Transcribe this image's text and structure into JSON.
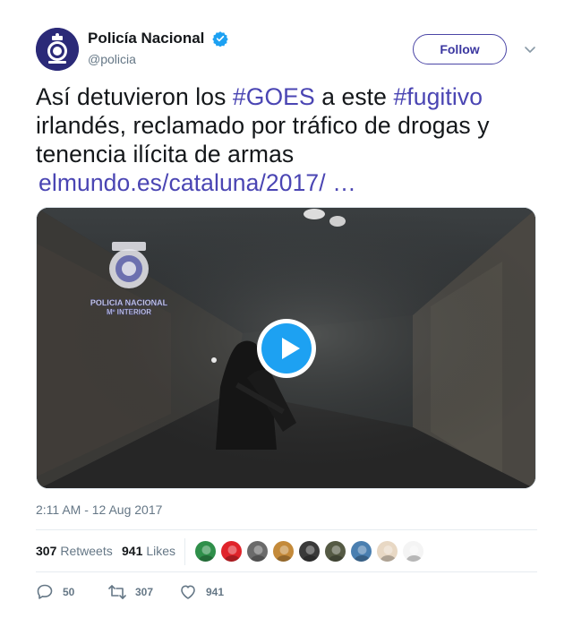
{
  "account": {
    "display_name": "Policía Nacional",
    "handle": "@policia",
    "verified": true
  },
  "follow_button": {
    "label": "Follow"
  },
  "tweet": {
    "line1_pre": "Así detuvieron los ",
    "hashtag1": "#GOES",
    "line1_mid": " a este ",
    "hashtag2": "#fugitivo",
    "line2": "irlandés, reclamado por tráfico de drogas y",
    "line3": "tenencia ilícita de armas",
    "link": "elmundo.es/cataluna/2017/ …"
  },
  "media": {
    "watermark_line1": "POLICIA NACIONAL",
    "watermark_line2": "Mº INTERIOR",
    "play_icon": "play-icon"
  },
  "timestamp": "2:11 AM - 12 Aug 2017",
  "stats": {
    "retweets_count": "307",
    "retweets_label": "Retweets",
    "likes_count": "941",
    "likes_label": "Likes",
    "liker_avatars": [
      {
        "name": "liker-avatar-1",
        "color": "#2f8f4a"
      },
      {
        "name": "liker-avatar-2",
        "color": "#e0242b"
      },
      {
        "name": "liker-avatar-3",
        "color": "#6b6b6b"
      },
      {
        "name": "liker-avatar-4",
        "color": "#c48a3a"
      },
      {
        "name": "liker-avatar-5",
        "color": "#3a3a3a"
      },
      {
        "name": "liker-avatar-6",
        "color": "#555a44"
      },
      {
        "name": "liker-avatar-7",
        "color": "#4a7fb0"
      },
      {
        "name": "liker-avatar-8",
        "color": "#e8d8c4"
      },
      {
        "name": "liker-avatar-9",
        "color": "#f4f4f4"
      }
    ]
  },
  "actions": {
    "reply_count": "50",
    "retweet_count": "307",
    "like_count": "941"
  },
  "colors": {
    "accent": "#4a45b3",
    "play_button": "#1da1f2",
    "text": "#14171a",
    "muted": "#657786"
  }
}
